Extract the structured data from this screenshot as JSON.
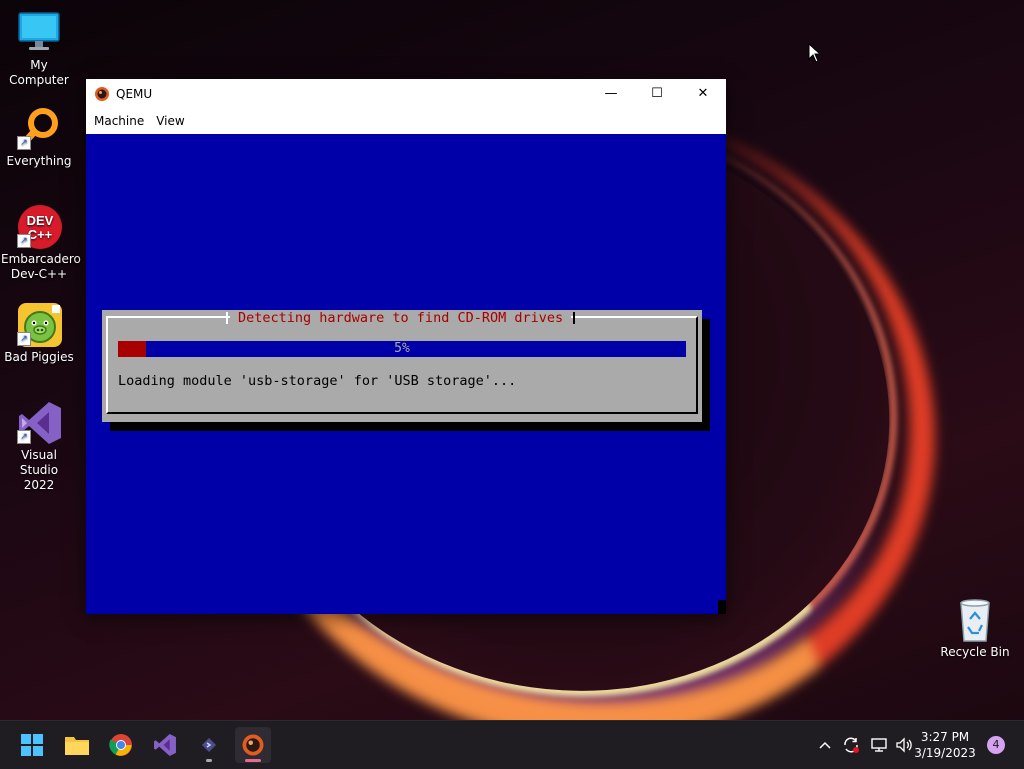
{
  "desktop": {
    "icons": [
      {
        "label": "My Computer",
        "icon": "computer-icon"
      },
      {
        "label": "Everything",
        "icon": "search-magnifier-icon"
      },
      {
        "label": "Embarcadero Dev-C++",
        "line1": "Embarcadero",
        "line2": "Dev-C++",
        "icon": "devcpp-icon",
        "badge": "DEV C++"
      },
      {
        "label": "Bad Piggies",
        "icon": "bad-piggies-icon"
      },
      {
        "label": "Visual Studio 2022",
        "line1": "Visual Studio",
        "line2": "2022",
        "icon": "visual-studio-icon"
      },
      {
        "label": "Recycle Bin",
        "icon": "recycle-bin-icon"
      }
    ]
  },
  "qemu": {
    "title": "QEMU",
    "menu": [
      "Machine",
      "View"
    ],
    "controls": {
      "minimize": "—",
      "maximize": "☐",
      "close": "✕"
    },
    "installer": {
      "dialog_title": "Detecting hardware to find CD-ROM drives",
      "progress_percent": 5,
      "progress_label": "5%",
      "message": "Loading module 'usb-storage' for 'USB storage'..."
    }
  },
  "taskbar": {
    "apps": [
      "start-icon",
      "file-explorer-icon",
      "chrome-icon",
      "visual-studio-icon",
      "terminal-icon",
      "qemu-icon"
    ],
    "clock": {
      "time": "3:27 PM",
      "date": "3/19/2023"
    },
    "notification_count": "4"
  },
  "colors": {
    "vm_background": "#0000a8",
    "dialog_gray": "#aaaaaa",
    "accent_red": "#a80000"
  }
}
